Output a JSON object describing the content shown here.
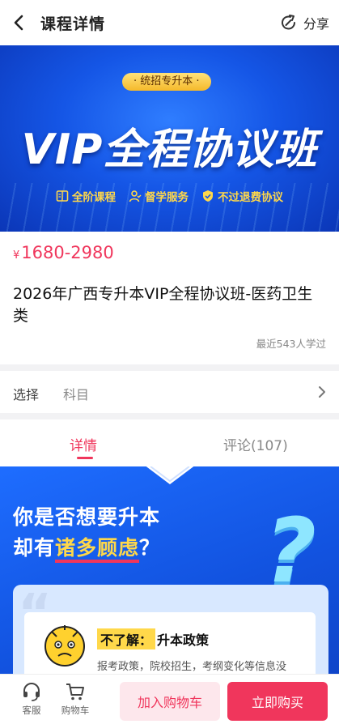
{
  "header": {
    "title": "课程详情",
    "share_label": "分享"
  },
  "banner": {
    "tag": "· 统招专升本 ·",
    "title": "VIP全程协议班",
    "features": [
      "全阶课程",
      "督学服务",
      "不过退费协议"
    ]
  },
  "course": {
    "price_symbol": "¥",
    "price": "1680-2980",
    "title": "2026年广西专升本VIP全程协议班-医药卫生类",
    "learned": "最近543人学过"
  },
  "select": {
    "label": "选择",
    "value": "科目"
  },
  "tabs": {
    "detail": "详情",
    "review": "评论(107)"
  },
  "content": {
    "headline_line1": "你是否想要升本",
    "headline_line2_a": "却有",
    "headline_line2_b": "诸多顾虑",
    "headline_line2_c": "？",
    "qmark": "?",
    "tag_mark": "不了解：",
    "tag_text": "升本政策",
    "desc": "报考政策，院校招生，考纲变化等信息没"
  },
  "bottom": {
    "service": "客服",
    "cart": "购物车",
    "add_cart": "加入购物车",
    "buy_now": "立即购买"
  },
  "colors": {
    "accent": "#f0365c",
    "banner_blue": "#1556e6",
    "gold": "#ffd84a"
  }
}
